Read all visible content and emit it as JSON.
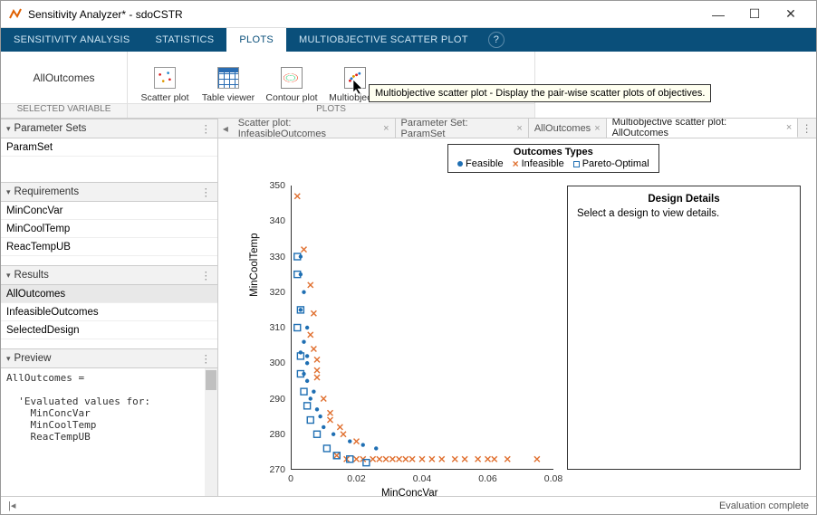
{
  "window": {
    "title": "Sensitivity Analyzer* - sdoCSTR"
  },
  "tabs": {
    "sensitivity": "SENSITIVITY ANALYSIS",
    "statistics": "STATISTICS",
    "plots": "PLOTS",
    "multiobj": "MULTIOBJECTIVE SCATTER PLOT"
  },
  "toolstrip": {
    "selected_var_label": "SELECTED VARIABLE",
    "selected_var": "AllOutcomes",
    "plots_label": "PLOTS",
    "buttons": {
      "scatter": "Scatter plot",
      "table": "Table viewer",
      "contour": "Contour plot",
      "multiobj": "Multiobjectiv"
    },
    "tooltip": "Multiobjective scatter plot - Display the pair-wise scatter plots of objectives."
  },
  "panels": {
    "param_sets": {
      "title": "Parameter Sets",
      "items": [
        "ParamSet"
      ]
    },
    "requirements": {
      "title": "Requirements",
      "items": [
        "MinConcVar",
        "MinCoolTemp",
        "ReacTempUB"
      ]
    },
    "results": {
      "title": "Results",
      "items": [
        "AllOutcomes",
        "InfeasibleOutcomes",
        "SelectedDesign"
      ],
      "selected": 0
    },
    "preview": {
      "title": "Preview",
      "text": "AllOutcomes =\n\n  'Evaluated values for:\n    MinConcVar\n    MinCoolTemp\n    ReacTempUB"
    }
  },
  "doctabs": {
    "t0": {
      "label": "Scatter plot: InfeasibleOutcomes"
    },
    "t1": {
      "label": "Parameter Set: ParamSet"
    },
    "t2": {
      "label": "AllOutcomes"
    },
    "t3": {
      "label": "Multiobjective scatter plot: AllOutcomes"
    }
  },
  "plot": {
    "legend_title": "Outcomes Types",
    "legend": {
      "a": "Feasible",
      "b": "Infeasible",
      "c": "Pareto-Optimal"
    },
    "ylabel": "MinCoolTemp",
    "xlabel": "MinConcVar",
    "details_title": "Design Details",
    "details_text": "Select a design to view details.",
    "yticks": [
      "270",
      "280",
      "290",
      "300",
      "310",
      "320",
      "330",
      "340",
      "350"
    ],
    "xticks": [
      "0",
      "0.02",
      "0.04",
      "0.06",
      "0.08"
    ]
  },
  "chart_data": {
    "type": "scatter",
    "title": "Multiobjective scatter plot: AllOutcomes",
    "xlabel": "MinConcVar",
    "ylabel": "MinCoolTemp",
    "xlim": [
      0,
      0.08
    ],
    "ylim": [
      270,
      350
    ],
    "series": [
      {
        "name": "Feasible",
        "marker": "dot",
        "color": "#1f6fb3",
        "points": [
          [
            0.003,
            330
          ],
          [
            0.003,
            325
          ],
          [
            0.004,
            320
          ],
          [
            0.003,
            315
          ],
          [
            0.005,
            310
          ],
          [
            0.004,
            306
          ],
          [
            0.003,
            303
          ],
          [
            0.005,
            302
          ],
          [
            0.005,
            300
          ],
          [
            0.004,
            297
          ],
          [
            0.005,
            295
          ],
          [
            0.007,
            292
          ],
          [
            0.006,
            290
          ],
          [
            0.008,
            287
          ],
          [
            0.009,
            285
          ],
          [
            0.01,
            282
          ],
          [
            0.013,
            280
          ],
          [
            0.018,
            278
          ],
          [
            0.022,
            277
          ],
          [
            0.026,
            276
          ]
        ]
      },
      {
        "name": "Infeasible",
        "marker": "x",
        "color": "#e07030",
        "points": [
          [
            0.002,
            347
          ],
          [
            0.004,
            332
          ],
          [
            0.006,
            322
          ],
          [
            0.007,
            314
          ],
          [
            0.006,
            308
          ],
          [
            0.007,
            304
          ],
          [
            0.008,
            301
          ],
          [
            0.008,
            298
          ],
          [
            0.008,
            296
          ],
          [
            0.01,
            290
          ],
          [
            0.012,
            286
          ],
          [
            0.012,
            284
          ],
          [
            0.015,
            282
          ],
          [
            0.016,
            280
          ],
          [
            0.02,
            278
          ],
          [
            0.014,
            274
          ],
          [
            0.017,
            273
          ],
          [
            0.02,
            273
          ],
          [
            0.022,
            273
          ],
          [
            0.025,
            273
          ],
          [
            0.027,
            273
          ],
          [
            0.029,
            273
          ],
          [
            0.031,
            273
          ],
          [
            0.033,
            273
          ],
          [
            0.035,
            273
          ],
          [
            0.037,
            273
          ],
          [
            0.04,
            273
          ],
          [
            0.043,
            273
          ],
          [
            0.046,
            273
          ],
          [
            0.05,
            273
          ],
          [
            0.053,
            273
          ],
          [
            0.057,
            273
          ],
          [
            0.06,
            273
          ],
          [
            0.062,
            273
          ],
          [
            0.066,
            273
          ],
          [
            0.075,
            273
          ]
        ]
      },
      {
        "name": "Pareto-Optimal",
        "marker": "square",
        "color": "#1f6fb3",
        "points": [
          [
            0.002,
            330
          ],
          [
            0.002,
            325
          ],
          [
            0.003,
            315
          ],
          [
            0.002,
            310
          ],
          [
            0.003,
            302
          ],
          [
            0.003,
            297
          ],
          [
            0.004,
            292
          ],
          [
            0.005,
            288
          ],
          [
            0.006,
            284
          ],
          [
            0.008,
            280
          ],
          [
            0.011,
            276
          ],
          [
            0.014,
            274
          ],
          [
            0.018,
            273
          ],
          [
            0.023,
            272
          ]
        ]
      }
    ]
  },
  "status": {
    "right": "Evaluation complete"
  }
}
